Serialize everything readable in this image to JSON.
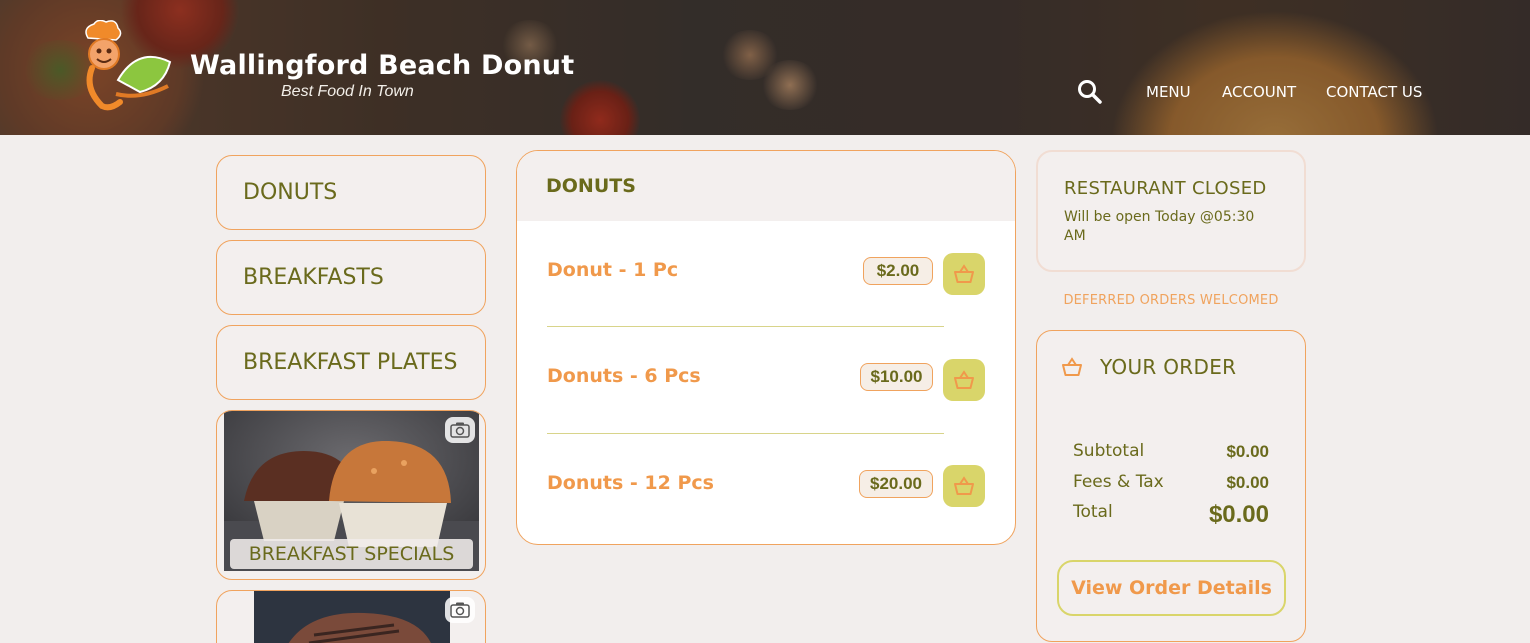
{
  "header": {
    "brand_title": "Wallingford Beach Donut",
    "brand_subtitle": "Best Food In Town",
    "nav": [
      "MENU",
      "ACCOUNT",
      "CONTACT US"
    ]
  },
  "categories": [
    {
      "label": "DONUTS"
    },
    {
      "label": "BREAKFASTS"
    },
    {
      "label": "BREAKFAST PLATES"
    },
    {
      "label": "BREAKFAST SPECIALS"
    }
  ],
  "menu": {
    "title": "DONUTS",
    "items": [
      {
        "name": "Donut - 1 Pc",
        "price": "$2.00"
      },
      {
        "name": "Donuts - 6 Pcs",
        "price": "$10.00"
      },
      {
        "name": "Donuts - 12 Pcs",
        "price": "$20.00"
      }
    ]
  },
  "status": {
    "title": "RESTAURANT CLOSED",
    "subtitle": "Will be open Today @05:30 AM",
    "deferred": "DEFERRED ORDERS WELCOMED"
  },
  "order": {
    "title": "YOUR ORDER",
    "subtotal_label": "Subtotal",
    "subtotal_value": "$0.00",
    "fees_label": "Fees & Tax",
    "fees_value": "$0.00",
    "total_label": "Total",
    "total_value": "$0.00",
    "view_button": "View Order Details"
  },
  "colors": {
    "accent_orange": "#f0a35e",
    "olive_text": "#6a6a1c",
    "cart_yellow": "#d9d56a",
    "background": "#f2eeed"
  },
  "icons": [
    "search-icon",
    "camera-icon",
    "basket-icon",
    "chef-logo"
  ]
}
